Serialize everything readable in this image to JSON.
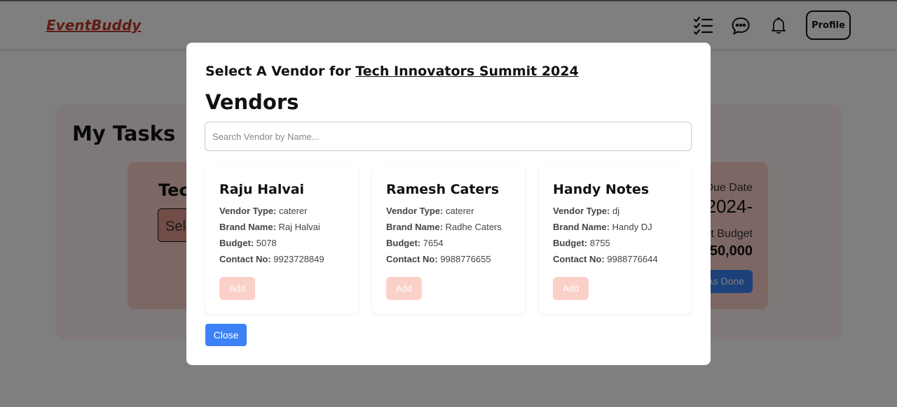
{
  "navbar": {
    "brand": "EventBuddy",
    "icons": [
      "tasks-checklist-icon",
      "chat-icon",
      "bell-icon"
    ],
    "profile_label": "Profile"
  },
  "page": {
    "title": "My Tasks",
    "task_card": {
      "name_partial": "Tec",
      "select_partial": "Sele",
      "due_label_partial": "Due Date",
      "due_value_partial": "-2024",
      "budget_label_partial": "t Budget",
      "budget_value_partial": "50,000",
      "done_label_partial": "As Done"
    }
  },
  "modal": {
    "heading_prefix": "Select A Vendor for ",
    "event_name": "Tech Innovators Summit 2024",
    "vendors_title": "Vendors",
    "search_placeholder": "Search Vendor by Name...",
    "field_labels": {
      "type": "Vendor Type:",
      "brand": "Brand Name:",
      "budget": "Budget:",
      "contact": "Contact No:"
    },
    "vendors": [
      {
        "name": "Raju Halvai",
        "type": "caterer",
        "brand": "Raj Halvai",
        "budget": "5078",
        "contact": "9923728849",
        "add_label": "Add"
      },
      {
        "name": "Ramesh Caters",
        "type": "caterer",
        "brand": "Radhe Caters",
        "budget": "7654",
        "contact": "9988776655",
        "add_label": "Add"
      },
      {
        "name": "Handy Notes",
        "type": "dj",
        "brand": "Handy DJ",
        "budget": "8755",
        "contact": "9988776644",
        "add_label": "Add"
      }
    ],
    "close_label": "Close"
  },
  "colors": {
    "brand": "#c0392b",
    "primary": "#3b82f6",
    "add_button": "#fbd0c8",
    "task_card": "#f8cfc8"
  }
}
